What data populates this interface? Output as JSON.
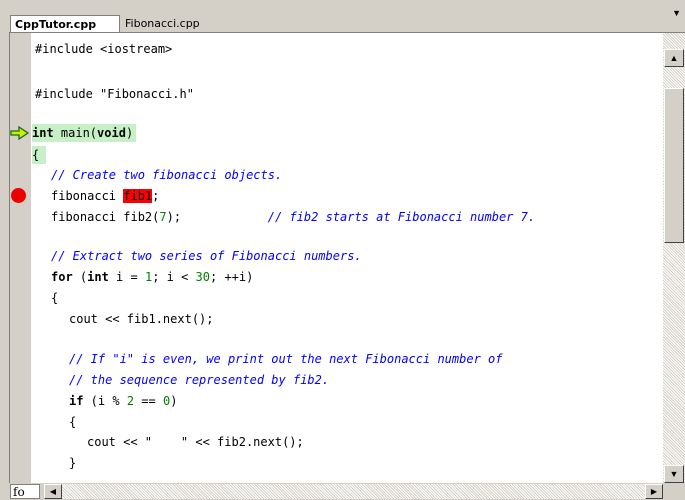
{
  "tabs": [
    {
      "label": "CppTutor.cpp",
      "active": true
    },
    {
      "label": "Fibonacci.cpp",
      "active": false
    }
  ],
  "tab_menu_icon": "dropdown-arrow-icon",
  "code": {
    "include1": "#include <iostream>",
    "include2": "#include \"Fibonacci.h\"",
    "main_kw1": "int",
    "main_mid": " main(",
    "main_kw2": "void",
    "main_end": ")",
    "brace_open": "{",
    "comment_create": "// Create two fibonacci objects.",
    "fib1_type": "fibonacci ",
    "fib1_name": "fib1",
    "fib1_end": ";",
    "fib2_pre": "fibonacci fib2(",
    "fib2_num": "7",
    "fib2_post": ");",
    "fib2_comment": "// fib2 starts at Fibonacci number 7.",
    "comment_extract": "// Extract two series of Fibonacci numbers.",
    "for_kw": "for",
    "for_a": " (",
    "for_int": "int",
    "for_b": " i = ",
    "for_n1": "1",
    "for_c": "; i < ",
    "for_n2": "30",
    "for_d": "; ++i)",
    "inner_open": "{",
    "cout1": "cout << fib1.next();",
    "comment_if1": "// If \"i\" is even, we print out the next Fibonacci number of",
    "comment_if2": "// the sequence represented by fib2.",
    "if_kw": "if",
    "if_a": " (i % ",
    "if_n1": "2",
    "if_b": " == ",
    "if_n2": "0",
    "if_c": ")",
    "if_open": "{",
    "cout2": "cout << \"    \" << fib2.next();",
    "if_close": "}"
  },
  "status_field": "fo",
  "colors": {
    "comment": "#0000ff",
    "number": "#008000",
    "current_line": "#c7f0c7",
    "breakpoint": "#ee0000",
    "selection": "#ff0000"
  },
  "icons": {
    "breakpoint": "breakpoint-icon",
    "execution": "execution-arrow-icon"
  }
}
